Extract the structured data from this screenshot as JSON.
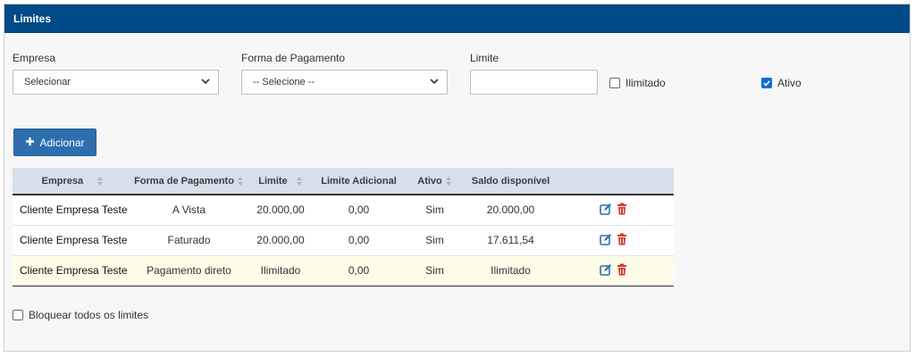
{
  "panel": {
    "title": "Limites"
  },
  "form": {
    "empresa": {
      "label": "Empresa",
      "value": "Selecionar"
    },
    "forma_pagamento": {
      "label": "Forma de Pagamento",
      "value": "-- Selecione --"
    },
    "limite": {
      "label": "Limite",
      "value": ""
    },
    "ilimitado": {
      "label": "Ilimitado",
      "checked": false
    },
    "ativo": {
      "label": "Ativo",
      "checked": true
    },
    "add_button": "Adicionar"
  },
  "table": {
    "columns": [
      "Empresa",
      "Forma de Pagamento",
      "Limite",
      "Limite Adicional",
      "Ativo",
      "Saldo disponível"
    ],
    "rows": [
      {
        "empresa": "Cliente Empresa Teste",
        "forma": "A Vista",
        "limite": "20.000,00",
        "adicional": "0,00",
        "ativo": "Sim",
        "saldo": "20.000,00"
      },
      {
        "empresa": "Cliente Empresa Teste",
        "forma": "Faturado",
        "limite": "20.000,00",
        "adicional": "0,00",
        "ativo": "Sim",
        "saldo": "17.611,54"
      },
      {
        "empresa": "Cliente Empresa Teste",
        "forma": "Pagamento direto",
        "limite": "Ilimitado",
        "adicional": "0,00",
        "ativo": "Sim",
        "saldo": "Ilimitado"
      }
    ]
  },
  "footer": {
    "bloquear_label": "Bloquear todos os limites",
    "bloquear_checked": false
  },
  "colors": {
    "header": "#004a87",
    "button": "#2d6fae",
    "edit_icon": "#2f6fb0",
    "delete_icon": "#d9342b",
    "table_header": "#d6dfeb",
    "highlight_row": "#fdfce8"
  },
  "icons": {
    "add": "plus-icon",
    "edit": "edit-icon",
    "delete": "trash-icon",
    "sort": "sort-icon",
    "dropdown": "chevron-down-icon"
  }
}
